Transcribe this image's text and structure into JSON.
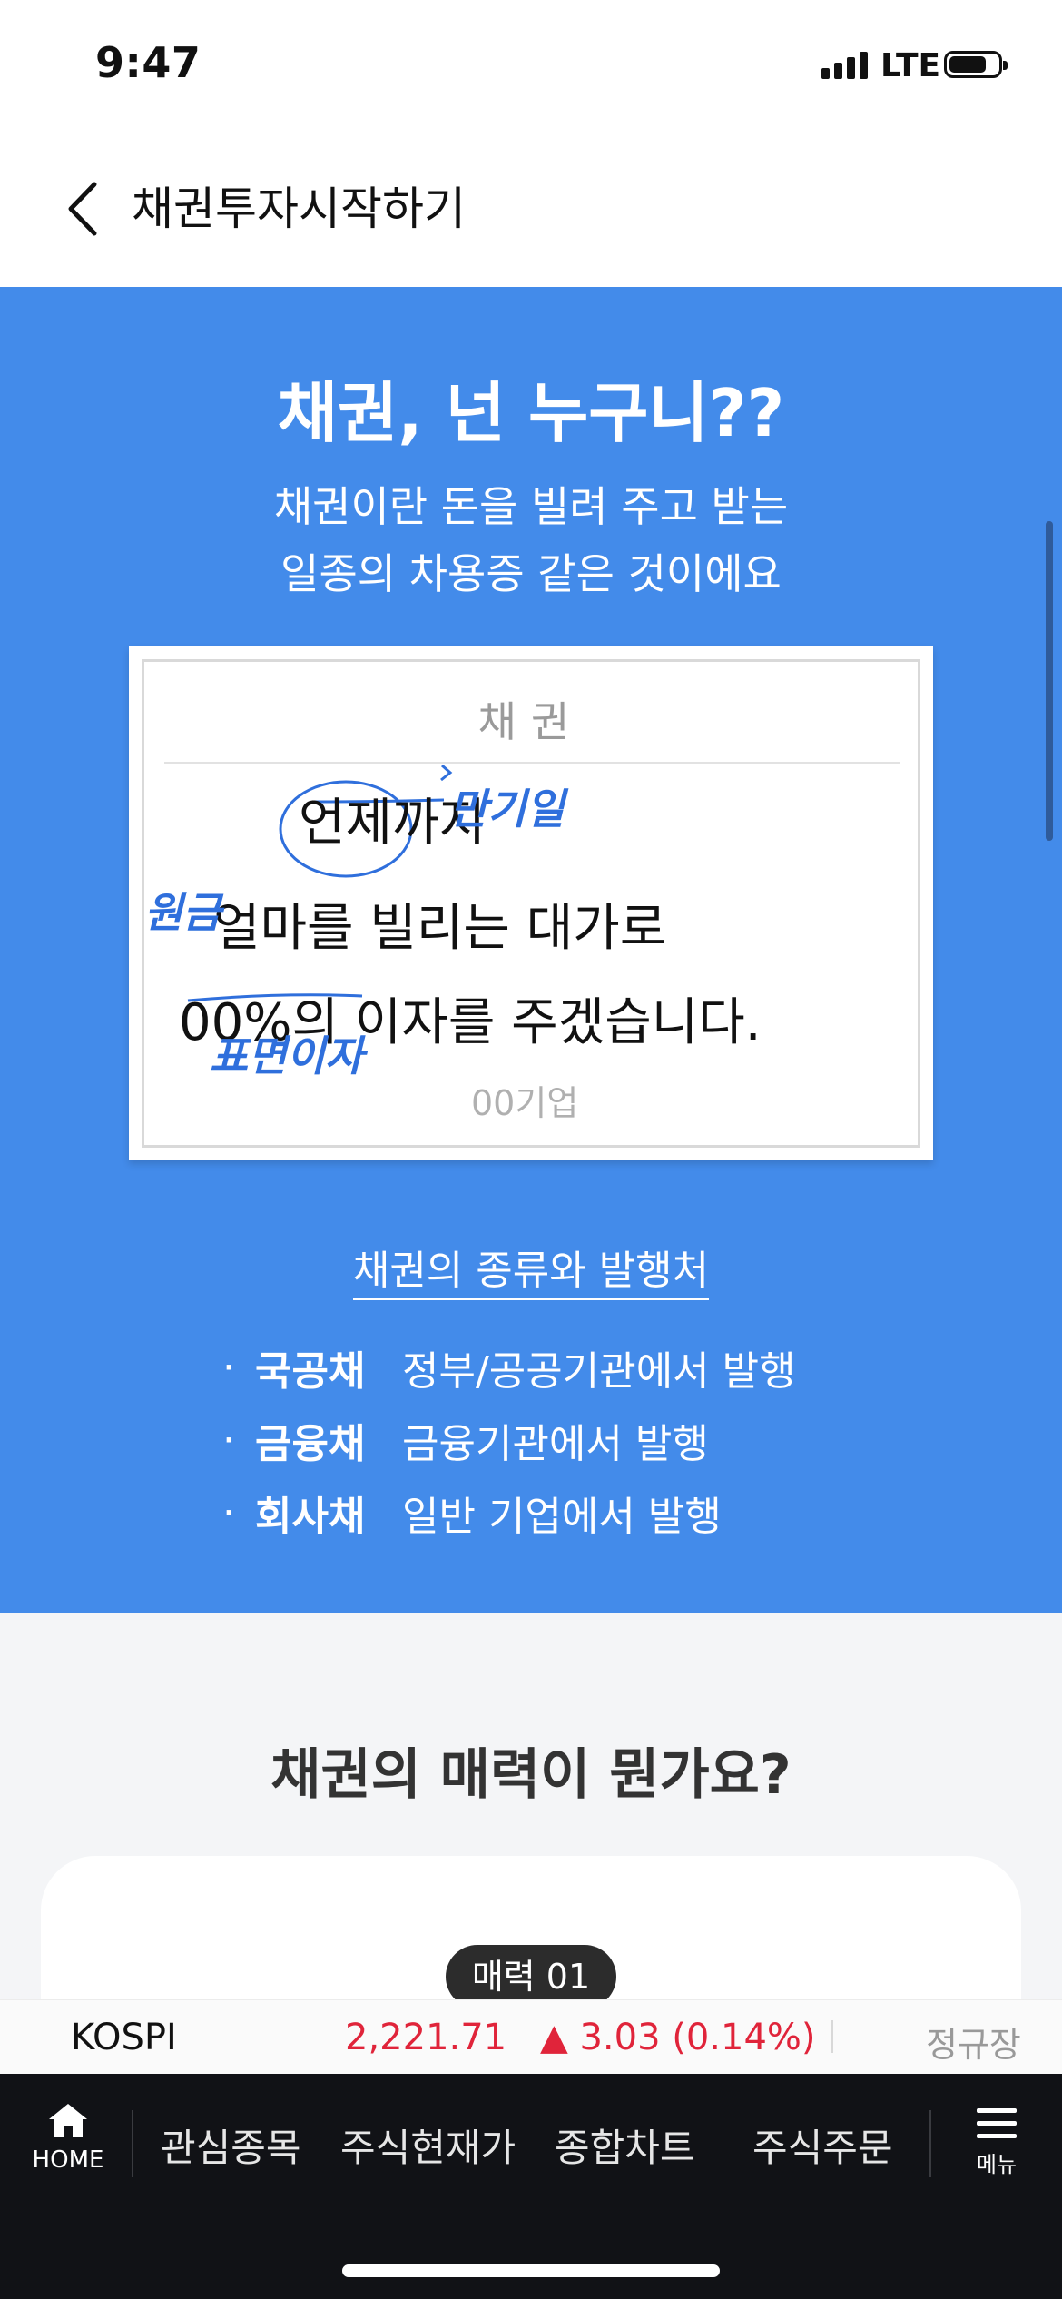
{
  "status_bar": {
    "time": "9:47",
    "network": "LTE"
  },
  "header": {
    "title": "채권투자시작하기"
  },
  "intro": {
    "title": "채권, 넌 누구니??",
    "subtitle_line1": "채권이란 돈을 빌려 주고 받는",
    "subtitle_line2": "일종의 차용증 같은 것이에요"
  },
  "bond_card": {
    "title": "채권",
    "line1": "언제까지",
    "line2": "얼마를 빌리는 대가로",
    "line3": "00%의 이자를 주겠습니다.",
    "issuer": "00기업",
    "annotations": {
      "maturity": "만기일",
      "principal": "원금",
      "coupon": "표면이자"
    }
  },
  "types": {
    "title": "채권의 종류와 발행처",
    "items": [
      {
        "name": "국공채",
        "desc": "정부/공공기관에서 발행"
      },
      {
        "name": "금융채",
        "desc": "금융기관에서 발행"
      },
      {
        "name": "회사채",
        "desc": "일반 기업에서 발행"
      }
    ]
  },
  "appeal": {
    "title": "채권의 매력이 뭔가요?",
    "badge": "매력 01"
  },
  "ticker": {
    "name": "KOSPI",
    "value": "2,221.71",
    "change": "▲ 3.03 (0.14%)",
    "session": "정규장",
    "change_color": "#e0243a"
  },
  "bottom_nav": {
    "home_label": "HOME",
    "items": [
      "관심종목",
      "주식현재가",
      "종합차트",
      "주식주문"
    ],
    "menu_label": "메뉴"
  },
  "colors": {
    "accent_blue": "#438bea",
    "handwriting_blue": "#2f6fdc"
  }
}
